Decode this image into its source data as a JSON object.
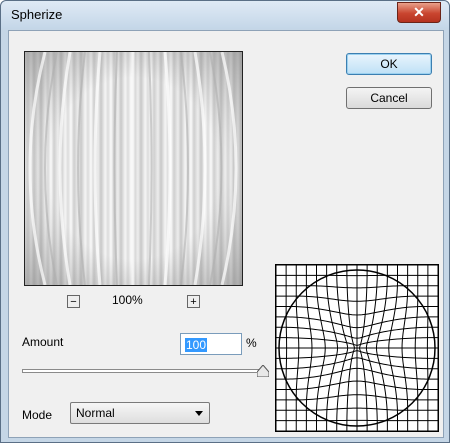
{
  "window": {
    "title": "Spherize",
    "close_symbol": "✕"
  },
  "buttons": {
    "ok": "OK",
    "cancel": "Cancel"
  },
  "zoom": {
    "minus": "−",
    "plus": "+",
    "level": "100%"
  },
  "amount": {
    "label": "Amount",
    "value": "100",
    "unit": "%",
    "slider_fraction": 1.0
  },
  "mode": {
    "label": "Mode",
    "selected": "Normal"
  },
  "colors": {
    "accent": "#3399ff",
    "close": "#c9452f",
    "titlebar": "#c5d6e6"
  }
}
